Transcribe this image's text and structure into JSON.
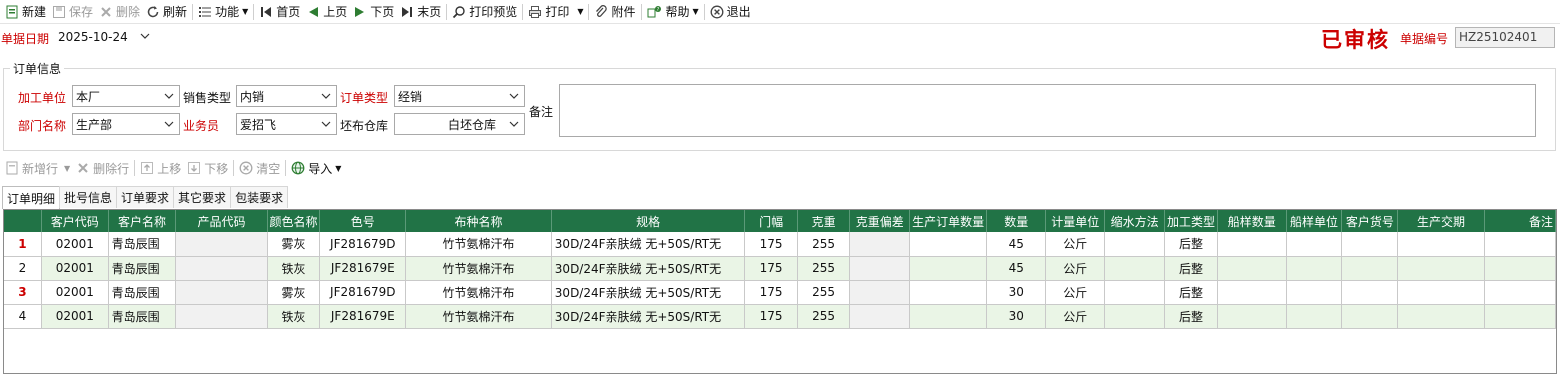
{
  "toolbar": {
    "new": "新建",
    "save": "保存",
    "delete": "删除",
    "refresh": "刷新",
    "function": "功能",
    "first": "首页",
    "prev": "上页",
    "next": "下页",
    "last": "末页",
    "print_preview": "打印预览",
    "print": "打印",
    "attachment": "附件",
    "help": "帮助",
    "exit": "退出"
  },
  "header": {
    "date_label": "单据日期",
    "date_value": "2025-10-24",
    "approved_stamp": "已审核",
    "doc_no_label": "单据编号",
    "doc_no_value": "HZ25102401"
  },
  "order_info": {
    "title": "订单信息",
    "process_unit_label": "加工单位",
    "process_unit_value": "本厂",
    "sales_type_label": "销售类型",
    "sales_type_value": "内销",
    "order_type_label": "订单类型",
    "order_type_value": "经销",
    "dept_label": "部门名称",
    "dept_value": "生产部",
    "salesman_label": "业务员",
    "salesman_value": "爱招飞",
    "warehouse_label": "坯布仓库",
    "warehouse_value": "白坯仓库",
    "remark_label": "备注"
  },
  "row_toolbar": {
    "add_row": "新增行",
    "delete_row": "删除行",
    "move_up": "上移",
    "move_down": "下移",
    "clear": "清空",
    "import": "导入"
  },
  "tabs": [
    "订单明细",
    "批号信息",
    "订单要求",
    "其它要求",
    "包装要求"
  ],
  "grid": {
    "columns": [
      "客户代码",
      "客户名称",
      "产品代码",
      "颜色名称",
      "色号",
      "布种名称",
      "规格",
      "门幅",
      "克重",
      "克重偏差",
      "生产订单数量",
      "数量",
      "计量单位",
      "缩水方法",
      "加工类型",
      "船样数量",
      "船样单位",
      "客户货号",
      "生产交期",
      "备注"
    ],
    "rows": [
      {
        "no": "1",
        "cells": [
          "02001",
          "青岛辰围",
          "",
          "雾灰",
          "JF281679D",
          "竹节氨棉汗布",
          "30D/24F亲肤绒 无+50S/RT无",
          "175",
          "255",
          "",
          "",
          "45",
          "公斤",
          "",
          "后整",
          "",
          "",
          "",
          "",
          ""
        ]
      },
      {
        "no": "2",
        "cells": [
          "02001",
          "青岛辰围",
          "",
          "铁灰",
          "JF281679E",
          "竹节氨棉汗布",
          "30D/24F亲肤绒 无+50S/RT无",
          "175",
          "255",
          "",
          "",
          "45",
          "公斤",
          "",
          "后整",
          "",
          "",
          "",
          "",
          ""
        ]
      },
      {
        "no": "3",
        "cells": [
          "02001",
          "青岛辰围",
          "",
          "雾灰",
          "JF281679D",
          "竹节氨棉汗布",
          "30D/24F亲肤绒 无+50S/RT无",
          "175",
          "255",
          "",
          "",
          "30",
          "公斤",
          "",
          "后整",
          "",
          "",
          "",
          "",
          ""
        ]
      },
      {
        "no": "4",
        "cells": [
          "02001",
          "青岛辰围",
          "",
          "铁灰",
          "JF281679E",
          "竹节氨棉汗布",
          "30D/24F亲肤绒 无+50S/RT无",
          "175",
          "255",
          "",
          "",
          "30",
          "公斤",
          "",
          "后整",
          "",
          "",
          "",
          "",
          ""
        ]
      }
    ]
  },
  "colors": {
    "header_green": "#217346",
    "alt_row": "#eaf5e6",
    "required_red": "#cc0000"
  }
}
